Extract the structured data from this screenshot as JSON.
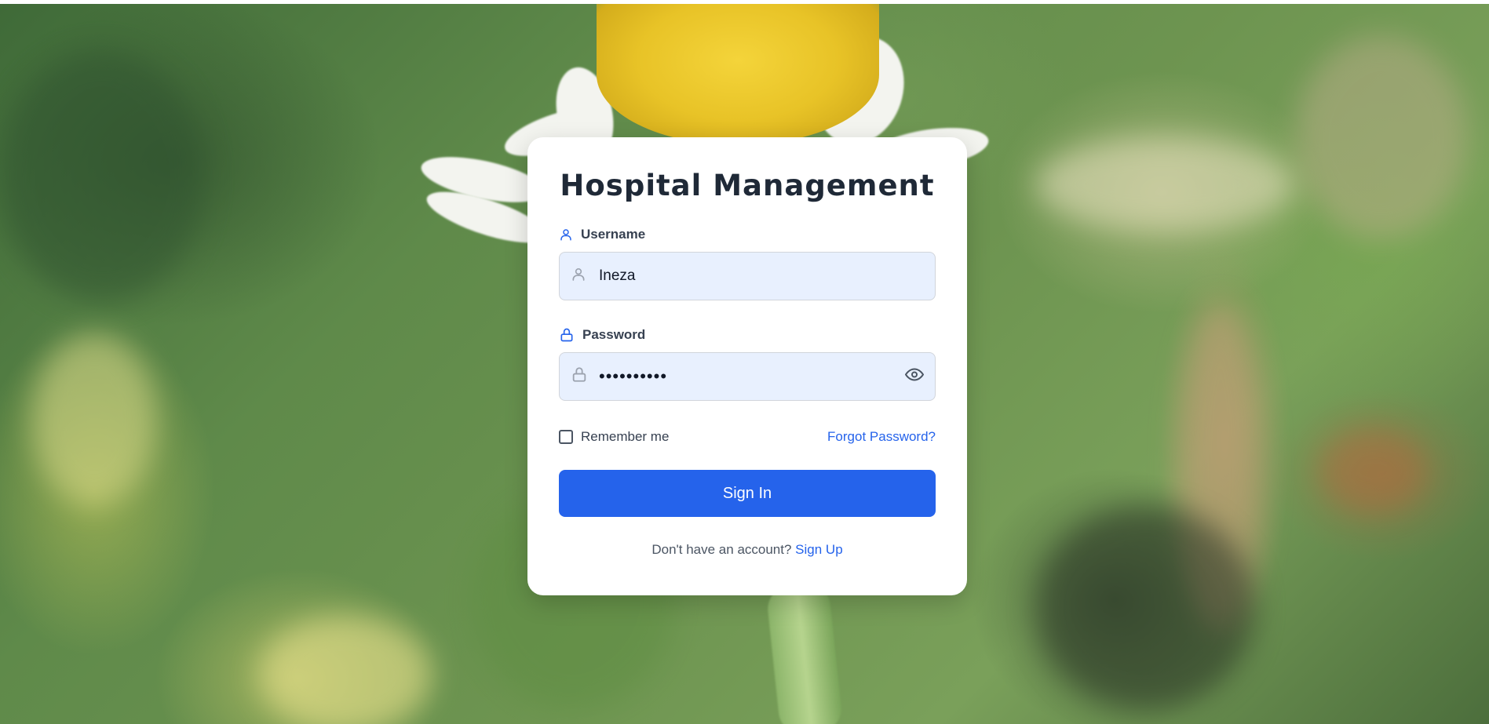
{
  "app": {
    "title": "Hospital Management"
  },
  "form": {
    "username": {
      "label": "Username",
      "value": "Ineza",
      "label_icon": "user-icon",
      "input_icon": "user-icon"
    },
    "password": {
      "label": "Password",
      "value": "••••••••••",
      "label_icon": "lock-icon",
      "input_icon": "lock-icon",
      "toggle_icon": "eye-icon"
    },
    "remember_label": "Remember me",
    "remember_checked": false,
    "forgot_label": "Forgot Password?",
    "submit_label": "Sign In",
    "signup_prompt": "Don't have an account?",
    "signup_link": "Sign Up"
  },
  "colors": {
    "primary": "#2563eb",
    "input_bg": "#e8f0fe",
    "title": "#1f2937",
    "card_bg": "#ffffff"
  }
}
